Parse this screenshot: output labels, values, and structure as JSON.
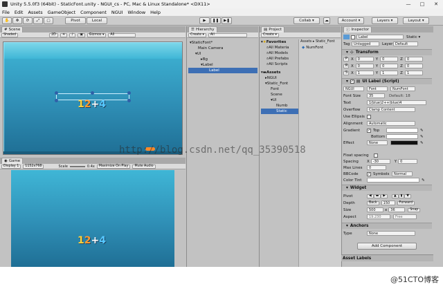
{
  "window": {
    "title": "Unity 5.5.0f3 (64bit) - StaticFont.unity - NGUI_cs - PC, Mac & Linux Standalone* <DX11>",
    "min": "—",
    "max": "□",
    "close": "✕"
  },
  "menu": [
    "File",
    "Edit",
    "Assets",
    "GameObject",
    "Component",
    "NGUI",
    "Window",
    "Help"
  ],
  "toolbar": {
    "pivot": "Pivot",
    "local": "Local",
    "play": "▶",
    "pause": "❚❚",
    "step": "▶❚",
    "collab": "Collab ▾",
    "account": "Account ▾",
    "layers": "Layers ▾",
    "layout": "Layout ▾"
  },
  "scene": {
    "tab": "Scene",
    "shaded": "Shaded",
    "mode2d": "2D",
    "gizmos": "Gizmos ▾",
    "search": "All"
  },
  "game": {
    "tab": "Game",
    "display": "Display 1",
    "resolution": "1152x768",
    "scale": "Scale",
    "scale_value": "0.4x",
    "maximize": "Maximize On Play",
    "mute": "Mute Audio"
  },
  "label_digits": [
    "1",
    "2",
    "+",
    "4"
  ],
  "hierarchy": {
    "tab": "Hierarchy",
    "create": "Create ▾",
    "search": "All",
    "items": [
      {
        "label": "StaticFont*",
        "indent": 0
      },
      {
        "label": "Main Camera",
        "indent": 1
      },
      {
        "label": "UI",
        "indent": 1
      },
      {
        "label": "Bg",
        "indent": 2
      },
      {
        "label": "Label",
        "indent": 2
      },
      {
        "label": "Label",
        "indent": 3
      }
    ]
  },
  "project": {
    "tab": "Project",
    "create": "Create ▾",
    "breadcrumb": "Assets ▸ Static_Font",
    "favorites_label": "Favorites",
    "favorites": [
      "All Materia",
      "All Models",
      "All Prefabs",
      "All Scripts"
    ],
    "assets_label": "Assets",
    "assets": [
      {
        "label": "NGUI",
        "indent": 1
      },
      {
        "label": "Static_Font",
        "indent": 1
      },
      {
        "label": "Font",
        "indent": 2
      },
      {
        "label": "Scene",
        "indent": 2
      },
      {
        "label": "UI",
        "indent": 2
      },
      {
        "label": "Numb",
        "indent": 3
      },
      {
        "label": "Static",
        "indent": 3
      }
    ],
    "file": "NumFont"
  },
  "inspector": {
    "tab": "Inspector",
    "object_name": "Label",
    "static": "Static ▾",
    "tag_label": "Tag",
    "tag": "Untagged",
    "layer_label": "Layer",
    "layer": "Default",
    "transform": {
      "title": "Transform",
      "position": [
        "0",
        "0",
        "0"
      ],
      "rotation": [
        "0",
        "0",
        "0"
      ],
      "scale": [
        "1",
        "1",
        "1"
      ]
    },
    "uilabel": {
      "title": "UI Label (Script)",
      "font_type": "NGUI",
      "font_kind": "Font",
      "font": "NumFont",
      "font_size_label": "Font Size",
      "font_size": "35",
      "font_default": "Default: 18",
      "text_label": "Text",
      "text": "1(blue)2++(blue)4",
      "overflow_label": "Overflow",
      "overflow": "Clamp Content",
      "ellipsis_label": "Use Ellipsis",
      "alignment_label": "Alignment",
      "alignment": "Automatic",
      "gradient_label": "Gradient",
      "top_label": "Top",
      "bottom_label": "Bottom",
      "effect_label": "Effect",
      "effect": "None",
      "spacing_label": "Float spacing",
      "spacing2_label": "Spacing",
      "spacing_x": "-30",
      "spacing_y": "0",
      "maxlines_label": "Max Lines",
      "maxlines": "0",
      "bbcode_label": "BBCode",
      "symbols_label": "Symbols",
      "symbols": "Normal",
      "tint_label": "Color Tint"
    },
    "widget": {
      "title": "Widget",
      "pivot_label": "Pivot",
      "depth_label": "Depth",
      "back": "Back",
      "depth": "150",
      "forward": "Forward",
      "size_label": "Size",
      "width": "500",
      "height": "36",
      "snap": "Snap",
      "aspect_label": "Aspect",
      "aspect": "19.230",
      "aspect_mode": "Free"
    },
    "anchors": {
      "title": "Anchors",
      "type_label": "Type",
      "type": "None"
    },
    "add_component": "Add Component",
    "asset_labels": "Asset Labels"
  },
  "watermark": "http://blog.csdn.net/qq_35390518",
  "badge": "@51CTO博客",
  "colors": {
    "selection": "#3d6fb5",
    "panel": "#c2c2c2",
    "water": "#2f8fb6"
  }
}
